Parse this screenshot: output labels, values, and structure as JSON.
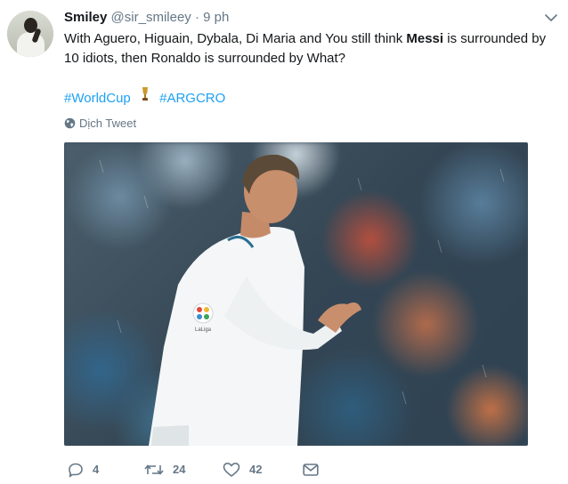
{
  "tweet": {
    "author_name": "Smiley",
    "author_handle": "@sir_smileey",
    "separator": "·",
    "time": "9 ph",
    "text_part1": "With Aguero, Higuain, Dybala, Di Maria and You still think ",
    "text_bold": "Messi",
    "text_part2": " is surrounded by 10 idiots, then Ronaldo is surrounded by What?",
    "hashtags": [
      "#WorldCup",
      "#ARGCRO"
    ],
    "translate_label": "Dịch Tweet",
    "photo_badge": "LaLiga"
  },
  "actions": {
    "reply_count": "4",
    "retweet_count": "24",
    "like_count": "42"
  },
  "colors": {
    "link": "#1da1f2",
    "secondary_text": "#657786",
    "primary_text": "#14171a"
  },
  "icons": [
    "chevron-down-icon",
    "trophy-icon",
    "globe-icon",
    "reply-icon",
    "retweet-icon",
    "like-icon",
    "message-icon"
  ]
}
